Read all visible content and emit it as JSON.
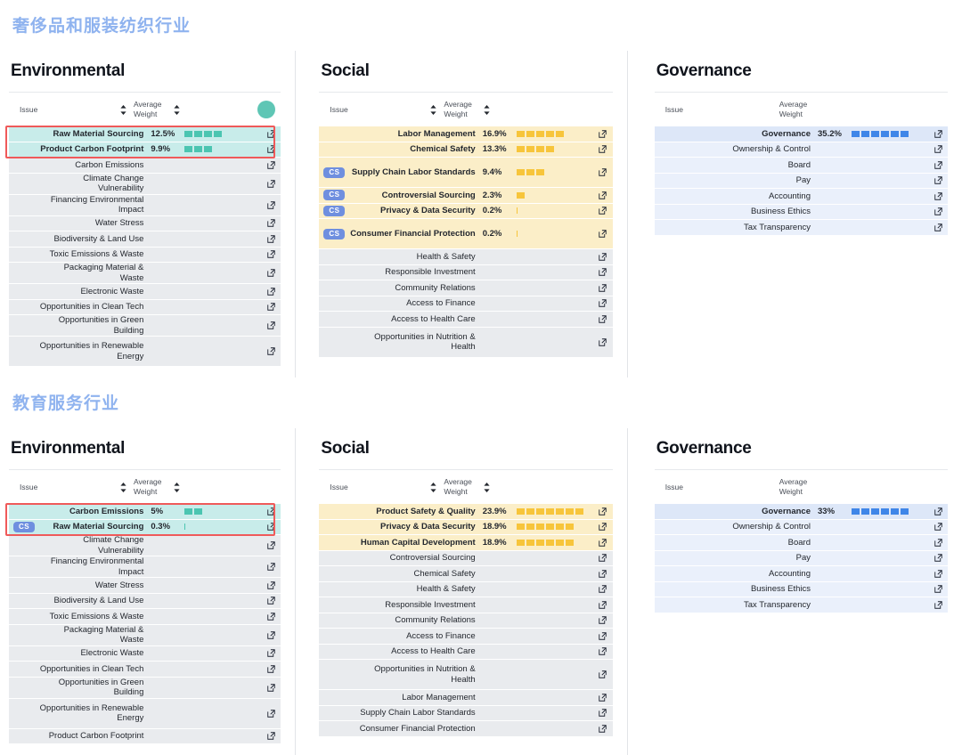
{
  "sections": [
    {
      "title": "奢侈品和服装纺织行业",
      "panels": {
        "environmental": {
          "heading": "Environmental",
          "columns": {
            "issue": "Issue",
            "weight": "Average Weight"
          },
          "badge_color": "#5fc6b5",
          "rows": [
            {
              "cs": false,
              "issue": "Raw Material Sourcing",
              "weight": "12.5%",
              "segments": 4,
              "highlight": true
            },
            {
              "cs": false,
              "issue": "Product Carbon Footprint",
              "weight": "9.9%",
              "segments": 3,
              "highlight": true
            },
            {
              "cs": false,
              "issue": "Carbon Emissions",
              "weight": "",
              "segments": 0,
              "highlight": false
            },
            {
              "cs": false,
              "issue": "Climate Change Vulnerability",
              "weight": "",
              "segments": 0,
              "highlight": false
            },
            {
              "cs": false,
              "issue": "Financing Environmental Impact",
              "weight": "",
              "segments": 0,
              "highlight": false
            },
            {
              "cs": false,
              "issue": "Water Stress",
              "weight": "",
              "segments": 0,
              "highlight": false
            },
            {
              "cs": false,
              "issue": "Biodiversity & Land Use",
              "weight": "",
              "segments": 0,
              "highlight": false
            },
            {
              "cs": false,
              "issue": "Toxic Emissions & Waste",
              "weight": "",
              "segments": 0,
              "highlight": false
            },
            {
              "cs": false,
              "issue": "Packaging Material & Waste",
              "weight": "",
              "segments": 0,
              "highlight": false
            },
            {
              "cs": false,
              "issue": "Electronic Waste",
              "weight": "",
              "segments": 0,
              "highlight": false
            },
            {
              "cs": false,
              "issue": "Opportunities in Clean Tech",
              "weight": "",
              "segments": 0,
              "highlight": false
            },
            {
              "cs": false,
              "issue": "Opportunities in Green Building",
              "weight": "",
              "segments": 0,
              "highlight": false
            },
            {
              "cs": false,
              "issue": "Opportunities in Renewable Energy",
              "weight": "",
              "segments": 0,
              "highlight": false,
              "tall": true
            }
          ]
        },
        "social": {
          "heading": "Social",
          "columns": {
            "issue": "Issue",
            "weight": "Average Weight"
          },
          "rows": [
            {
              "cs": false,
              "issue": "Labor Management",
              "weight": "16.9%",
              "segments": 5,
              "highlight": true
            },
            {
              "cs": false,
              "issue": "Chemical Safety",
              "weight": "13.3%",
              "segments": 4,
              "highlight": true
            },
            {
              "cs": true,
              "issue": "Supply Chain Labor Standards",
              "weight": "9.4%",
              "segments": 3,
              "highlight": true,
              "tall": true
            },
            {
              "cs": true,
              "issue": "Controversial Sourcing",
              "weight": "2.3%",
              "segments": 1,
              "highlight": true
            },
            {
              "cs": true,
              "issue": "Privacy & Data Security",
              "weight": "0.2%",
              "segments": 0,
              "sliver": true,
              "highlight": true
            },
            {
              "cs": true,
              "issue": "Consumer Financial Protection",
              "weight": "0.2%",
              "segments": 0,
              "sliver": true,
              "highlight": true,
              "tall": true
            },
            {
              "cs": false,
              "issue": "Health & Safety",
              "weight": "",
              "segments": 0,
              "highlight": false
            },
            {
              "cs": false,
              "issue": "Responsible Investment",
              "weight": "",
              "segments": 0,
              "highlight": false
            },
            {
              "cs": false,
              "issue": "Community Relations",
              "weight": "",
              "segments": 0,
              "highlight": false
            },
            {
              "cs": false,
              "issue": "Access to Finance",
              "weight": "",
              "segments": 0,
              "highlight": false
            },
            {
              "cs": false,
              "issue": "Access to Health Care",
              "weight": "",
              "segments": 0,
              "highlight": false
            },
            {
              "cs": false,
              "issue": "Opportunities in Nutrition & Health",
              "weight": "",
              "segments": 0,
              "highlight": false,
              "tall": true
            }
          ]
        },
        "governance": {
          "heading": "Governance",
          "columns": {
            "issue": "Issue",
            "weight": "Average Weight"
          },
          "rows": [
            {
              "cs": false,
              "issue": "Governance",
              "weight": "35.2%",
              "segments": 6,
              "highlight": true
            },
            {
              "cs": false,
              "issue": "Ownership & Control",
              "weight": "",
              "segments": 0,
              "highlight": false
            },
            {
              "cs": false,
              "issue": "Board",
              "weight": "",
              "segments": 0,
              "highlight": false
            },
            {
              "cs": false,
              "issue": "Pay",
              "weight": "",
              "segments": 0,
              "highlight": false
            },
            {
              "cs": false,
              "issue": "Accounting",
              "weight": "",
              "segments": 0,
              "highlight": false
            },
            {
              "cs": false,
              "issue": "Business Ethics",
              "weight": "",
              "segments": 0,
              "highlight": false
            },
            {
              "cs": false,
              "issue": "Tax Transparency",
              "weight": "",
              "segments": 0,
              "highlight": false
            }
          ]
        }
      }
    },
    {
      "title": "教育服务行业",
      "panels": {
        "environmental": {
          "heading": "Environmental",
          "columns": {
            "issue": "Issue",
            "weight": "Average Weight"
          },
          "rows": [
            {
              "cs": false,
              "issue": "Carbon Emissions",
              "weight": "5%",
              "segments": 2,
              "highlight": true
            },
            {
              "cs": true,
              "issue": "Raw Material Sourcing",
              "weight": "0.3%",
              "segments": 0,
              "sliver": true,
              "highlight": true
            },
            {
              "cs": false,
              "issue": "Climate Change Vulnerability",
              "weight": "",
              "segments": 0,
              "highlight": false
            },
            {
              "cs": false,
              "issue": "Financing Environmental Impact",
              "weight": "",
              "segments": 0,
              "highlight": false
            },
            {
              "cs": false,
              "issue": "Water Stress",
              "weight": "",
              "segments": 0,
              "highlight": false
            },
            {
              "cs": false,
              "issue": "Biodiversity & Land Use",
              "weight": "",
              "segments": 0,
              "highlight": false
            },
            {
              "cs": false,
              "issue": "Toxic Emissions & Waste",
              "weight": "",
              "segments": 0,
              "highlight": false
            },
            {
              "cs": false,
              "issue": "Packaging Material & Waste",
              "weight": "",
              "segments": 0,
              "highlight": false
            },
            {
              "cs": false,
              "issue": "Electronic Waste",
              "weight": "",
              "segments": 0,
              "highlight": false
            },
            {
              "cs": false,
              "issue": "Opportunities in Clean Tech",
              "weight": "",
              "segments": 0,
              "highlight": false
            },
            {
              "cs": false,
              "issue": "Opportunities in Green Building",
              "weight": "",
              "segments": 0,
              "highlight": false
            },
            {
              "cs": false,
              "issue": "Opportunities in Renewable Energy",
              "weight": "",
              "segments": 0,
              "highlight": false,
              "tall": true
            },
            {
              "cs": false,
              "issue": "Product Carbon Footprint",
              "weight": "",
              "segments": 0,
              "highlight": false
            }
          ]
        },
        "social": {
          "heading": "Social",
          "columns": {
            "issue": "Issue",
            "weight": "Average Weight"
          },
          "rows": [
            {
              "cs": false,
              "issue": "Product Safety & Quality",
              "weight": "23.9%",
              "segments": 7,
              "highlight": true
            },
            {
              "cs": false,
              "issue": "Privacy & Data Security",
              "weight": "18.9%",
              "segments": 6,
              "highlight": true
            },
            {
              "cs": false,
              "issue": "Human Capital Development",
              "weight": "18.9%",
              "segments": 6,
              "highlight": true
            },
            {
              "cs": false,
              "issue": "Controversial Sourcing",
              "weight": "",
              "segments": 0,
              "highlight": false
            },
            {
              "cs": false,
              "issue": "Chemical Safety",
              "weight": "",
              "segments": 0,
              "highlight": false
            },
            {
              "cs": false,
              "issue": "Health & Safety",
              "weight": "",
              "segments": 0,
              "highlight": false
            },
            {
              "cs": false,
              "issue": "Responsible Investment",
              "weight": "",
              "segments": 0,
              "highlight": false
            },
            {
              "cs": false,
              "issue": "Community Relations",
              "weight": "",
              "segments": 0,
              "highlight": false
            },
            {
              "cs": false,
              "issue": "Access to Finance",
              "weight": "",
              "segments": 0,
              "highlight": false
            },
            {
              "cs": false,
              "issue": "Access to Health Care",
              "weight": "",
              "segments": 0,
              "highlight": false
            },
            {
              "cs": false,
              "issue": "Opportunities in Nutrition & Health",
              "weight": "",
              "segments": 0,
              "highlight": false,
              "tall": true
            },
            {
              "cs": false,
              "issue": "Labor Management",
              "weight": "",
              "segments": 0,
              "highlight": false
            },
            {
              "cs": false,
              "issue": "Supply Chain Labor Standards",
              "weight": "",
              "segments": 0,
              "highlight": false
            },
            {
              "cs": false,
              "issue": "Consumer Financial Protection",
              "weight": "",
              "segments": 0,
              "highlight": false
            }
          ]
        },
        "governance": {
          "heading": "Governance",
          "columns": {
            "issue": "Issue",
            "weight": "Average Weight"
          },
          "rows": [
            {
              "cs": false,
              "issue": "Governance",
              "weight": "33%",
              "segments": 6,
              "highlight": true
            },
            {
              "cs": false,
              "issue": "Ownership & Control",
              "weight": "",
              "segments": 0,
              "highlight": false
            },
            {
              "cs": false,
              "issue": "Board",
              "weight": "",
              "segments": 0,
              "highlight": false
            },
            {
              "cs": false,
              "issue": "Pay",
              "weight": "",
              "segments": 0,
              "highlight": false
            },
            {
              "cs": false,
              "issue": "Accounting",
              "weight": "",
              "segments": 0,
              "highlight": false
            },
            {
              "cs": false,
              "issue": "Business Ethics",
              "weight": "",
              "segments": 0,
              "highlight": false
            },
            {
              "cs": false,
              "issue": "Tax Transparency",
              "weight": "",
              "segments": 0,
              "highlight": false
            }
          ]
        }
      }
    }
  ],
  "labels": {
    "cs_badge": "CS",
    "external_link_icon": "external-link-icon",
    "sort_icon": "sort-updown-icon"
  },
  "colors": {
    "title": "#8fb3ef",
    "env_accent": "#4bc5b1",
    "soc_accent": "#f7c53b",
    "gov_accent": "#3f86e8",
    "env_row": "#c8ecea",
    "soc_row": "#fbeec8",
    "gov_row": "#eaf0fb",
    "plain_row": "#e9ebee",
    "cs_badge": "#6f8fdf",
    "redbox": "#ef5a5a"
  }
}
